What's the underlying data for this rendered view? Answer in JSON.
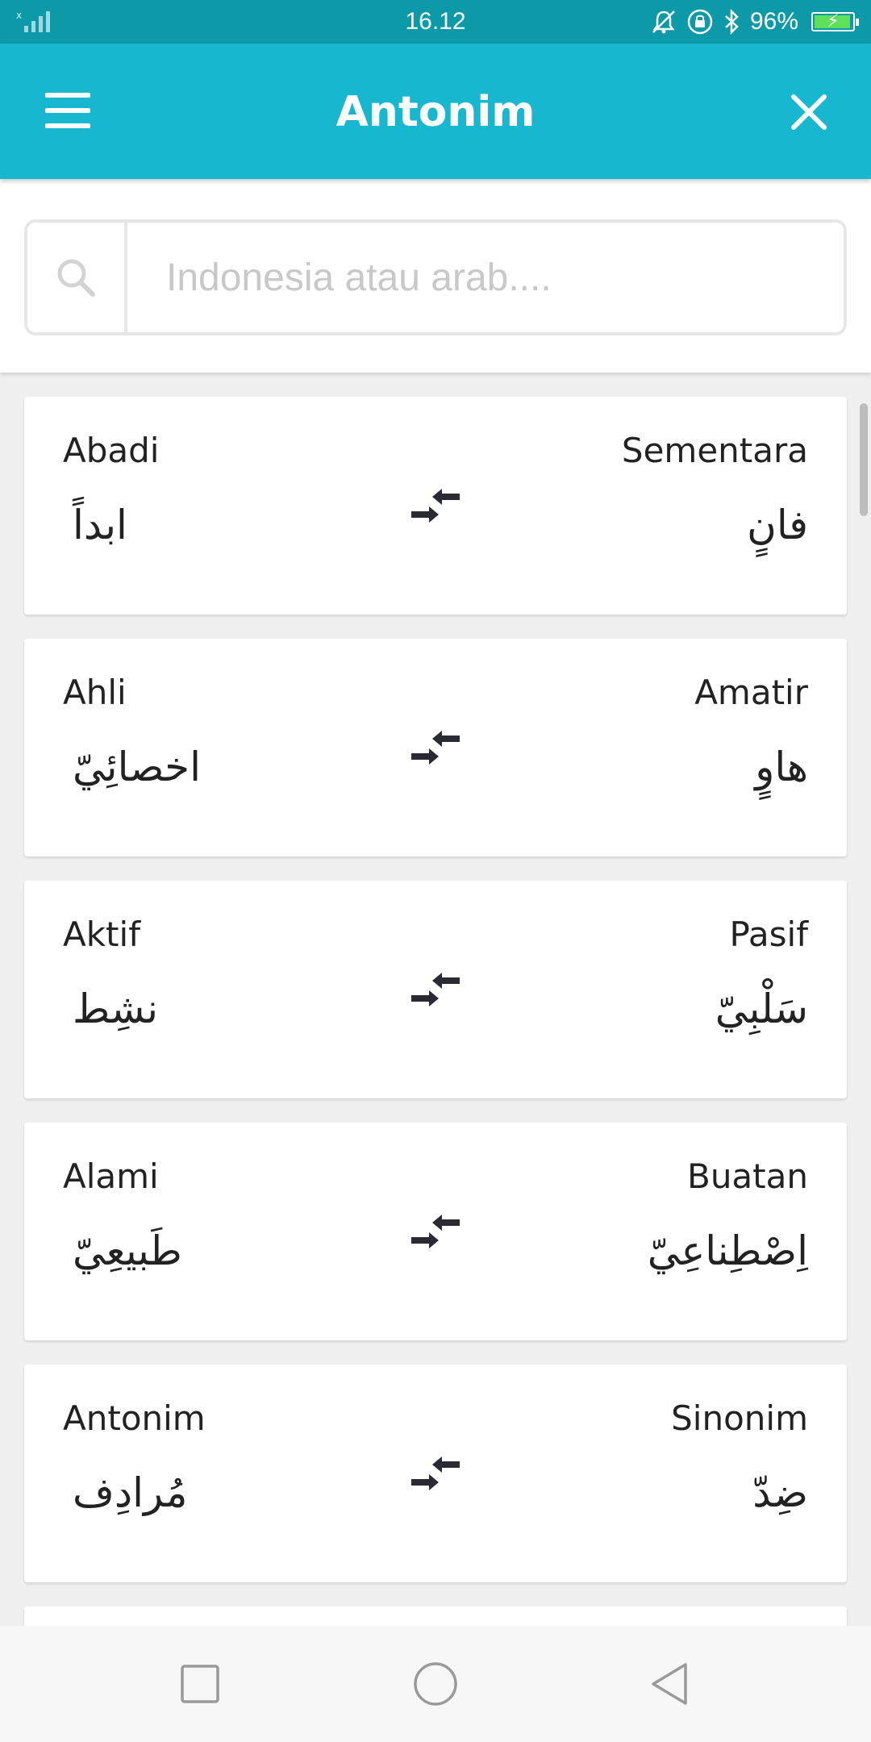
{
  "status_bar": {
    "time": "16.12",
    "battery": "96%",
    "battery_level": 0.96
  },
  "app_bar": {
    "title": "Antonim",
    "menu_icon": "hamburger-menu-icon",
    "close_icon": "close-icon"
  },
  "search": {
    "placeholder": "Indonesia atau arab....",
    "value": "",
    "icon": "search-icon"
  },
  "antonyms": [
    {
      "left_word": "Abadi",
      "left_arabic": "ابداً",
      "right_word": "Sementara",
      "right_arabic": "فانٍ"
    },
    {
      "left_word": "Ahli",
      "left_arabic": "اخصائِيّ",
      "right_word": "Amatir",
      "right_arabic": "هاوٍ"
    },
    {
      "left_word": "Aktif",
      "left_arabic": "نشِط",
      "right_word": "Pasif",
      "right_arabic": "سَلْبِيّ"
    },
    {
      "left_word": "Alami",
      "left_arabic": "طَبيعِيّ",
      "right_word": "Buatan",
      "right_arabic": "اِصْطِناعِيّ"
    },
    {
      "left_word": "Antonim",
      "left_arabic": "مُرادِف",
      "right_word": "Sinonim",
      "right_arabic": "ضِدّ"
    }
  ],
  "colors": {
    "status_bar": "#0d9aa8",
    "app_bar": "#17b7cf",
    "background": "#efefef"
  }
}
